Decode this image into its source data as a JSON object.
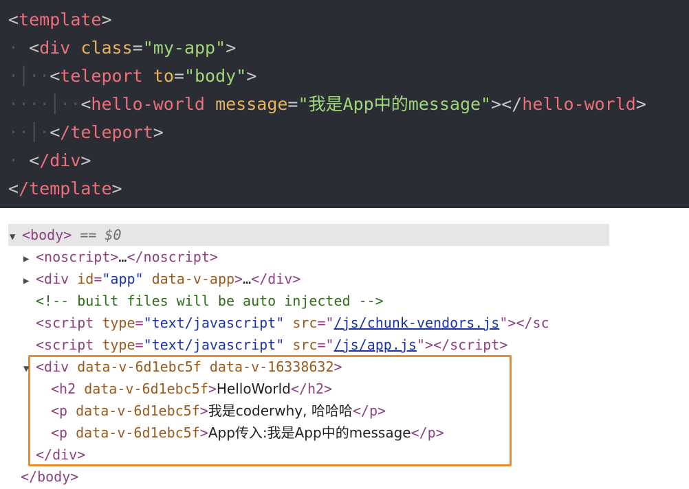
{
  "editor": {
    "lines": [
      {
        "tag": "template",
        "close": ">"
      },
      {
        "tag": "div",
        "attr": "class",
        "value": "\"my-app\""
      },
      {
        "tag": "teleport",
        "attr": "to",
        "value": "\"body\""
      },
      {
        "tag": "hello-world",
        "attr": "message",
        "value": "\"我是App中的message\"",
        "closing_tag": "hello-world"
      },
      {
        "tag": "/teleport"
      },
      {
        "tag": "/div"
      },
      {
        "tag": "/template"
      }
    ]
  },
  "devtools": {
    "body_open": "body",
    "selected_marker": "== $0",
    "noscript": "noscript",
    "ellipsis": "…",
    "noscript_close": "/noscript",
    "app_div": {
      "tag": "div",
      "id_attr": "id",
      "id_value": "\"app\"",
      "data_attr": "data-v-app",
      "close": "/div"
    },
    "comment": "<!-- built files will be auto injected -->",
    "script1": {
      "tag": "script",
      "type_attr": "type",
      "type_value": "\"text/javascript\"",
      "src_attr": "src",
      "src_value": "/js/chunk-vendors.js",
      "close": "></sc"
    },
    "script2": {
      "tag": "script",
      "type_attr": "type",
      "type_value": "\"text/javascript\"",
      "src_attr": "src",
      "src_value": "/js/app.js",
      "close": "/script"
    },
    "teleported": {
      "div_tag": "div",
      "div_attrs": "data-v-6d1ebc5f data-v-16338632",
      "h2_tag": "h2",
      "scope_attr": "data-v-6d1ebc5f",
      "h2_text": "HelloWorld",
      "h2_close": "/h2",
      "p_tag": "p",
      "p1_text": "我是coderwhy, 哈哈哈",
      "p_close": "/p",
      "p2_text": "App传入:我是App中的message",
      "div_close": "/div"
    },
    "body_close": "/body",
    "highlight_color": "#f08a24"
  }
}
